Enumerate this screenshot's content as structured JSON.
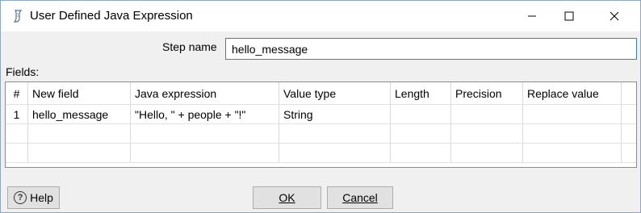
{
  "window": {
    "title": "User Defined Java Expression",
    "title_icon": "java-script-icon",
    "controls": {
      "minimize": "minimize-icon",
      "maximize": "maximize-icon",
      "close": "close-icon"
    }
  },
  "step": {
    "label": "Step name",
    "value": "hello_message"
  },
  "fields": {
    "label": "Fields:",
    "columns": [
      "#",
      "New field",
      "Java expression",
      "Value type",
      "Length",
      "Precision",
      "Replace value"
    ],
    "rows": [
      [
        "1",
        "hello_message",
        "\"Hello, \" + people + \"!\"",
        "String",
        "",
        "",
        ""
      ]
    ]
  },
  "buttons": {
    "help": "Help",
    "help_icon": "question-circle-icon",
    "ok": "OK",
    "cancel": "Cancel"
  },
  "colors": {
    "input_border": "#3c7fb1",
    "dialog_bg": "#f0f0f0",
    "button_bg": "#e1e1e1"
  }
}
